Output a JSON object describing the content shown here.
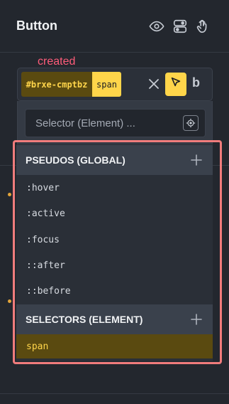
{
  "header": {
    "title": "Button",
    "icons": [
      "eye-icon",
      "toggle-layout-icon",
      "touch-hand-icon"
    ]
  },
  "annotation": {
    "label": "created"
  },
  "selector_bar": {
    "id_chip": "#brxe-cmptbz",
    "tag_chip": "span",
    "icons": [
      "close-icon",
      "cursor-arrow-icon",
      "bricks-b-icon"
    ],
    "b_label": "b"
  },
  "search": {
    "placeholder": "Selector (Element) ..."
  },
  "pseudos": {
    "heading": "PSEUDOS (GLOBAL)",
    "items": [
      ":hover",
      ":active",
      ":focus",
      "::after",
      "::before"
    ]
  },
  "selectors": {
    "heading": "SELECTORS (ELEMENT)",
    "items": [
      "span"
    ]
  },
  "colors": {
    "accent": "#ffd54a",
    "selected_bg": "#5a4a10",
    "annotation": "#ff5c7a",
    "frame": "#f07c7c"
  }
}
